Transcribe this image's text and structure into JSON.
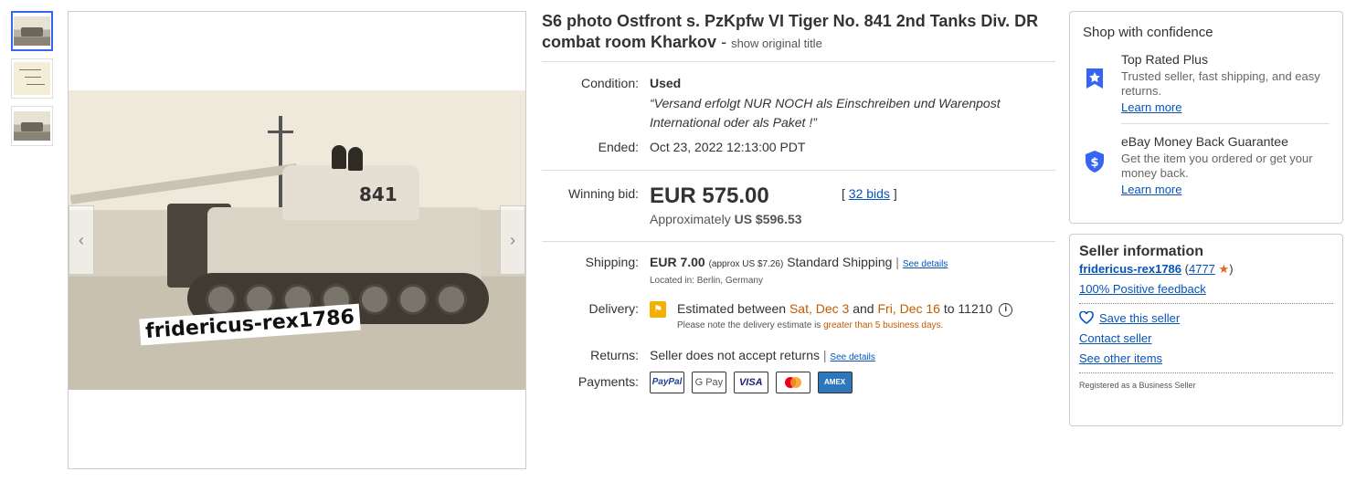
{
  "thumbnails": [
    {
      "name": "thumbnail-1",
      "active": true
    },
    {
      "name": "thumbnail-2",
      "active": false
    },
    {
      "name": "thumbnail-3",
      "active": false
    }
  ],
  "image": {
    "tank_number": "841",
    "watermark": "fridericus-rex1786",
    "prev_arrow": "‹",
    "next_arrow": "›"
  },
  "listing": {
    "title": "S6 photo Ostfront s. PzKpfw VI Tiger No. 841 2nd Tanks Div. DR combat room Kharkov",
    "dash": "-",
    "show_original": "show original title",
    "condition_label": "Condition:",
    "condition_value": "Used",
    "condition_note": "“Versand erfolgt NUR NOCH als Einschreiben und Warenpost International oder als Paket !”",
    "ended_label": "Ended:",
    "ended_value": "Oct 23, 2022 12:13:00 PDT",
    "winning_bid_label": "Winning bid:",
    "winning_bid_value": "EUR 575.00",
    "approx_prefix": "Approximately",
    "approx_value": "US $596.53",
    "bids_link": "32 bids",
    "shipping_label": "Shipping:",
    "shipping_value": "EUR 7.00",
    "shipping_approx": "(approx US $7.26)",
    "shipping_method": "Standard Shipping",
    "shipping_see_details": "See details",
    "located_in": "Located in: Berlin, Germany",
    "delivery_label": "Delivery:",
    "delivery_prefix": "Estimated between",
    "delivery_start": "Sat, Dec 3",
    "delivery_and": "and",
    "delivery_end": "Fri, Dec 16",
    "delivery_to": "to 11210",
    "delivery_note_prefix": "Please note the delivery estimate is",
    "delivery_note_highlight": "greater than 5 business days.",
    "returns_label": "Returns:",
    "returns_value": "Seller does not accept returns",
    "returns_see_details": "See details",
    "payments_label": "Payments:",
    "payment_methods": [
      "PayPal",
      "G Pay",
      "VISA",
      "Mastercard",
      "AMEX"
    ]
  },
  "confidence": {
    "title": "Shop with confidence",
    "top_rated_title": "Top Rated Plus",
    "top_rated_desc": "Trusted seller, fast shipping, and easy returns.",
    "top_rated_link": "Learn more",
    "money_back_title": "eBay Money Back Guarantee",
    "money_back_desc": "Get the item you ordered or get your money back.",
    "money_back_link": "Learn more"
  },
  "seller": {
    "title": "Seller information",
    "name": "fridericus-rex1786",
    "feedback_score": "4777",
    "positive_feedback": "100% Positive feedback",
    "save_seller": "Save this seller",
    "contact_seller": "Contact seller",
    "see_other_items": "See other items",
    "registered": "Registered as a Business Seller"
  },
  "colors": {
    "link": "#0654ba",
    "accent_blue": "#3665f3",
    "delivery_orange": "#c25b00",
    "star": "#e9621e"
  }
}
